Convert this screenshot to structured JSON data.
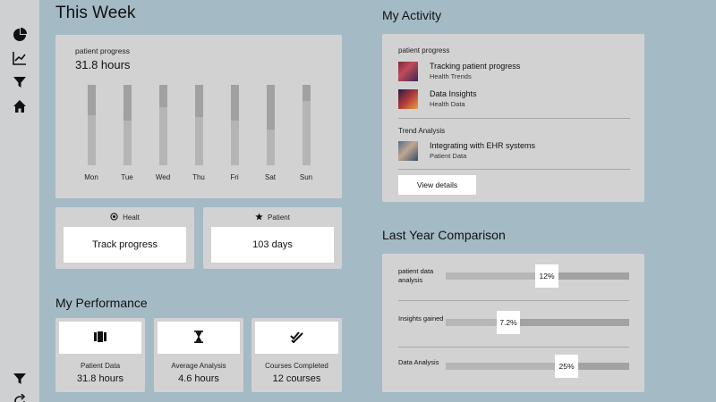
{
  "colors": {
    "background": "#a4bac5",
    "card": "#d3d2d3",
    "sidebar": "#cfd0d1"
  },
  "sidebar": {
    "icons": [
      "pie-chart-icon",
      "line-chart-icon",
      "filter-icon",
      "home-icon"
    ],
    "bottom_icons": [
      "filter-icon",
      "refresh-icon"
    ]
  },
  "this_week": {
    "title": "This Week",
    "label": "patient progress",
    "total": "31.8 hours",
    "days": [
      {
        "day": "Mon",
        "level": 0.62
      },
      {
        "day": "Tue",
        "level": 0.55
      },
      {
        "day": "Wed",
        "level": 0.72
      },
      {
        "day": "Thu",
        "level": 0.6
      },
      {
        "day": "Fri",
        "level": 0.55
      },
      {
        "day": "Sat",
        "level": 0.45
      },
      {
        "day": "Sun",
        "level": 0.8
      }
    ]
  },
  "stats": [
    {
      "caption": "Healt",
      "icon": "target-icon",
      "value": "Track progress"
    },
    {
      "caption": "Patient",
      "icon": "star-icon",
      "value": "103 days"
    }
  ],
  "performance": {
    "title": "My Performance",
    "cards": [
      {
        "icon": "book-icon",
        "label": "Patient Data",
        "value": "31.8 hours"
      },
      {
        "icon": "hourglass-icon",
        "label": "Average Analysis",
        "value": "4.6 hours"
      },
      {
        "icon": "double-check-icon",
        "label": "Courses Completed",
        "value": "12 courses"
      }
    ]
  },
  "activity": {
    "title": "My Activity",
    "group1_label": "patient progress",
    "group1_items": [
      {
        "title": "Tracking patient progress",
        "subtitle": "Health Trends"
      },
      {
        "title": "Data Insights",
        "subtitle": "Health Data"
      }
    ],
    "group2_label": "Trend Analysis",
    "group2_items": [
      {
        "title": "Integrating with EHR systems",
        "subtitle": "Patient Data"
      }
    ],
    "button": "View details"
  },
  "comparison": {
    "title": "Last Year Comparison",
    "rows": [
      {
        "label": "patient data analysis",
        "value": "12%",
        "position": 0.55
      },
      {
        "label": "Insights gained",
        "value": "7.2%",
        "position": 0.34
      },
      {
        "label": "Data Analysis",
        "value": "25%",
        "position": 0.66
      }
    ]
  }
}
